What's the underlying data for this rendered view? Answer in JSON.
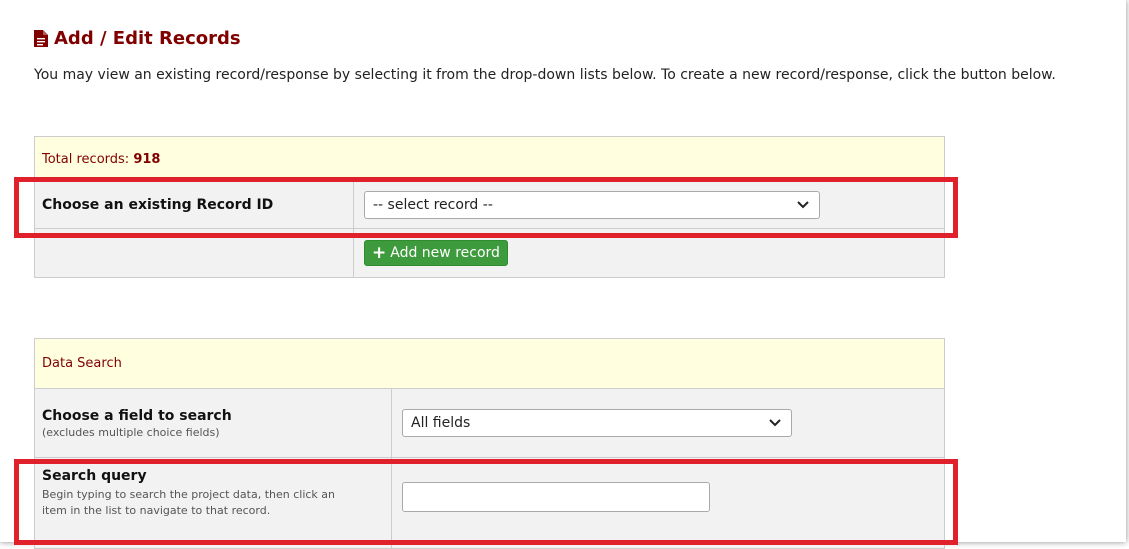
{
  "page": {
    "title": "Add / Edit Records",
    "intro": "You may view an existing record/response by selecting it from the drop-down lists below. To create a new record/response, click the button below."
  },
  "records": {
    "total_label": "Total records: ",
    "total_value": "918",
    "choose_label": "Choose an existing Record ID",
    "select_value": "-- select record --",
    "add_button": "Add new record"
  },
  "search": {
    "header": "Data Search",
    "field_label": "Choose a field to search",
    "field_note": "(excludes multiple choice fields)",
    "field_value": "All fields",
    "query_label": "Search query",
    "query_note": "Begin typing to search the project data, then click an item in the list to navigate to that record.",
    "query_value": ""
  },
  "icons": {
    "title_icon": "file-icon",
    "dropdown_icon": "chevron-down-icon",
    "add_icon": "plus-icon"
  },
  "colors": {
    "title": "#800000",
    "header_bg": "#ffffe0",
    "row_bg": "#f2f2f2",
    "button_bg": "#3d9b3d",
    "highlight": "#e0202a"
  }
}
